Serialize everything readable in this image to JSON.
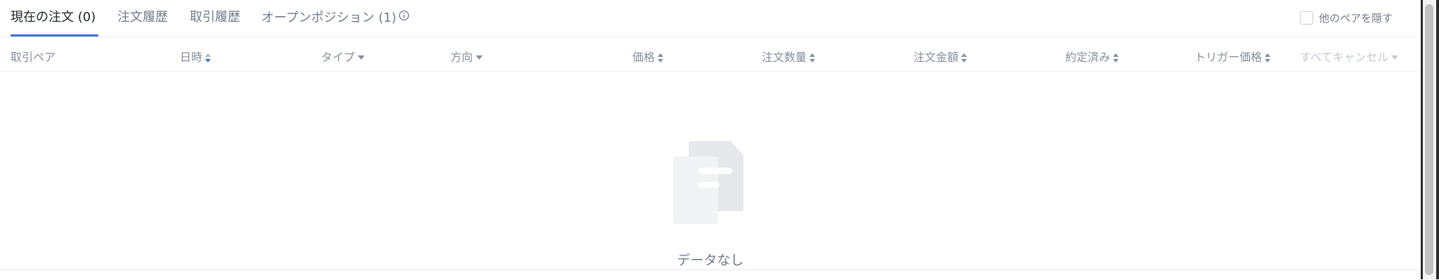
{
  "tabs": [
    {
      "label": "現在の注文 (0)",
      "active": true
    },
    {
      "label": "注文履歴",
      "active": false
    },
    {
      "label": "取引履歴",
      "active": false
    },
    {
      "label": "オープンポジション (1)",
      "active": false
    }
  ],
  "hide_other_pairs": {
    "label": "他のペアを隠す",
    "checked": false
  },
  "columns": [
    {
      "label": "取引ペア",
      "indicator": "none"
    },
    {
      "label": "日時",
      "indicator": "sort-desc-active"
    },
    {
      "label": "タイプ",
      "indicator": "dropdown"
    },
    {
      "label": "方向",
      "indicator": "dropdown"
    },
    {
      "label": "価格",
      "indicator": "sort"
    },
    {
      "label": "注文数量",
      "indicator": "sort"
    },
    {
      "label": "注文金額",
      "indicator": "sort"
    },
    {
      "label": "約定済み",
      "indicator": "sort"
    },
    {
      "label": "トリガー価格",
      "indicator": "sort"
    },
    {
      "label": "すべてキャンセル",
      "indicator": "dropdown"
    }
  ],
  "empty_state": {
    "text": "データなし",
    "icon": "empty-document-icon"
  },
  "colors": {
    "accent": "#3a6cd6",
    "text_primary": "#1e2329",
    "text_secondary": "#707a8a",
    "border": "#eaecef"
  }
}
